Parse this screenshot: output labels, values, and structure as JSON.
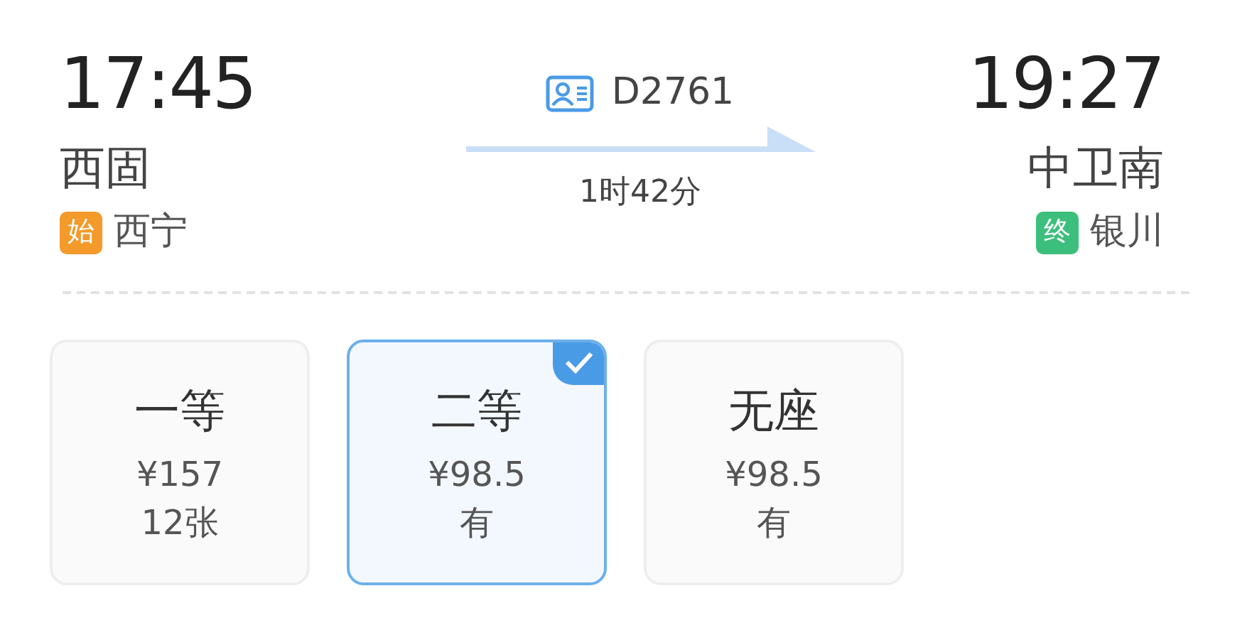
{
  "departure": {
    "time": "17:45",
    "station": "西固",
    "origin_badge": {
      "label": "始",
      "color": "#f39a2b"
    },
    "origin": "西宁"
  },
  "train": {
    "number": "D2761",
    "duration": "1时42分"
  },
  "arrival": {
    "time": "19:27",
    "station": "中卫南",
    "terminal_badge": {
      "label": "终",
      "color": "#3cbf7c"
    },
    "terminal": "银川"
  },
  "seats": [
    {
      "class": "一等",
      "price": "¥157",
      "availability": "12张",
      "selected": false
    },
    {
      "class": "二等",
      "price": "¥98.5",
      "availability": "有",
      "selected": true
    },
    {
      "class": "无座",
      "price": "¥98.5",
      "availability": "有",
      "selected": false
    }
  ]
}
